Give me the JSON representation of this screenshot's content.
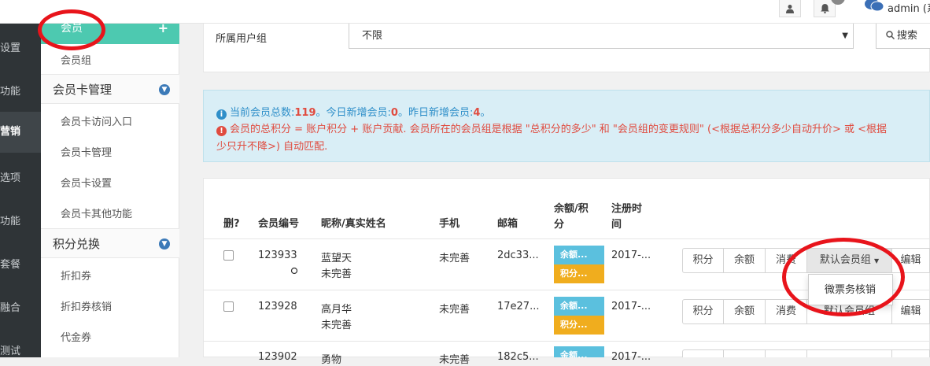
{
  "topbar": {
    "user_icon": "user-icon",
    "bell_icon": "bell-icon",
    "wechat_icon": "wechat-icon",
    "admin_label": "admin (系"
  },
  "leftnav": {
    "items": [
      "设置",
      "功能",
      "营销",
      "选项",
      "功能",
      "套餐",
      "融合",
      "测试"
    ],
    "active_index": 2
  },
  "submenu": {
    "active_label": "会员",
    "active_plus": "+",
    "member_group": "会员组",
    "card_section": "会员卡管理",
    "card_items": [
      "会员卡访问入口",
      "会员卡管理",
      "会员卡设置",
      "会员卡其他功能"
    ],
    "points_section": "积分兑换",
    "points_items": [
      "折扣券",
      "折扣券核销",
      "代金券"
    ]
  },
  "filter": {
    "label": "所属用户组",
    "select_value": "不限",
    "search_label": "搜索"
  },
  "info": {
    "line1_prefix": "当前会员总数:",
    "total": "119",
    "line1_mid": "。今日新增会员:",
    "today": "0",
    "line1_mid2": "。昨日新增会员:",
    "yesterday": "4",
    "line1_end": "。",
    "line2": "会员的总积分 = 账户积分 + 账户贡献. 会员所在的会员组是根据 \"总积分的多少\" 和 \"会员组的变更规则\" (<根据总积分多少自动升价> 或 <根据",
    "line3": "少只升不降>) 自动匹配."
  },
  "table": {
    "headers": {
      "del": "删?",
      "id": "会员编号",
      "name": "昵称/真实姓名",
      "phone": "手机",
      "email": "邮箱",
      "balance_a": "余额/积",
      "balance_b": "分",
      "reg_a": "注册时",
      "reg_b": "间"
    },
    "rows": [
      {
        "id": "123933",
        "nickname": "蓝望天",
        "realname": "未完善",
        "phone": "未完善",
        "email": "2dc33...",
        "balance": "余额...",
        "points": "积分...",
        "reg": "2017-..."
      },
      {
        "id": "123928",
        "nickname": "高月华",
        "realname": "未完善",
        "phone": "未完善",
        "email": "17e27...",
        "balance": "余额...",
        "points": "积分...",
        "reg": "2017-..."
      },
      {
        "id": "123902",
        "nickname": "勇物",
        "realname": "",
        "phone": "未完善",
        "email": "182c5...",
        "balance": "余额...",
        "points": "",
        "reg": "2017-..."
      }
    ],
    "actions": {
      "points": "积分",
      "balance": "余额",
      "consume": "消费",
      "group": "默认会员组",
      "edit": "编辑"
    },
    "dropdown_item": "微票务核销"
  },
  "colors": {
    "teal": "#4dc9b0",
    "annotation_red": "#e8141b",
    "info_blue": "#2f8fc9",
    "info_red": "#e04b3f",
    "tag_blue": "#5bc0de",
    "tag_orange": "#f0ad1e"
  }
}
